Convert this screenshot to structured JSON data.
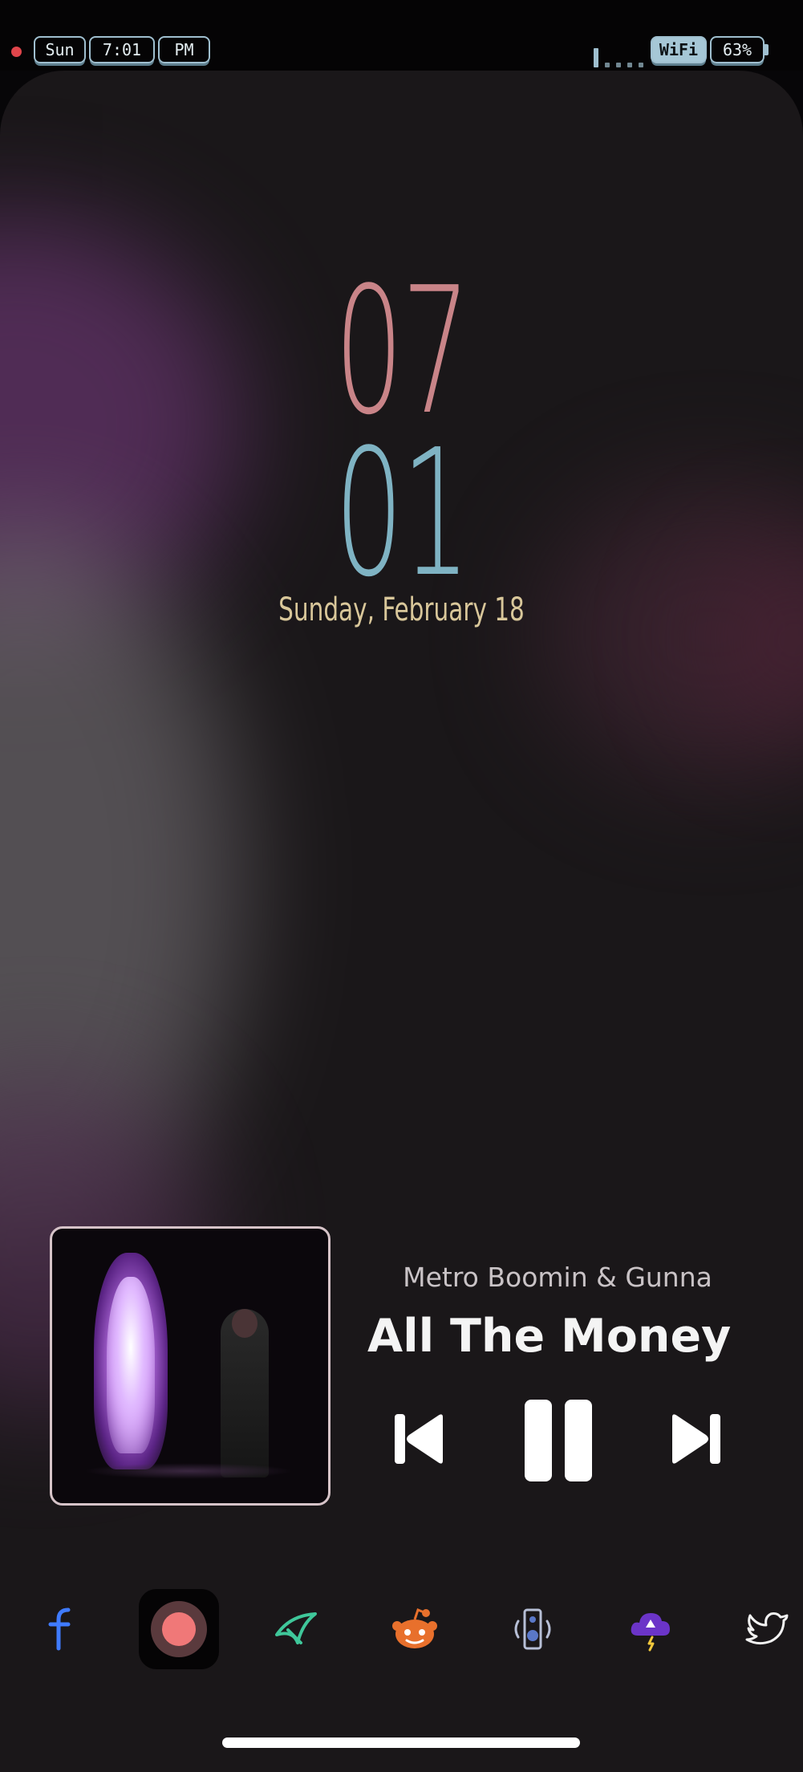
{
  "status_bar": {
    "day": "Sun",
    "time": "7:01",
    "ampm": "PM",
    "wifi_label": "WiFi",
    "battery": "63%"
  },
  "clock": {
    "hour": "07",
    "minute": "01",
    "date": "Sunday, February 18"
  },
  "now_playing": {
    "artist": "Metro Boomin & Gunna",
    "title": "All The Money (",
    "controls": [
      "previous",
      "pause",
      "next"
    ]
  },
  "dock": {
    "apps": [
      "facebook-icon",
      "screen-record-icon",
      "robinhood-icon",
      "reddit-icon",
      "speaker-icon",
      "weather-icon",
      "twitter-icon"
    ]
  },
  "colors": {
    "hour": "#c98488",
    "minute": "#7fb3c3",
    "date": "#d9c79a",
    "status_accent": "#9fbfcf"
  }
}
